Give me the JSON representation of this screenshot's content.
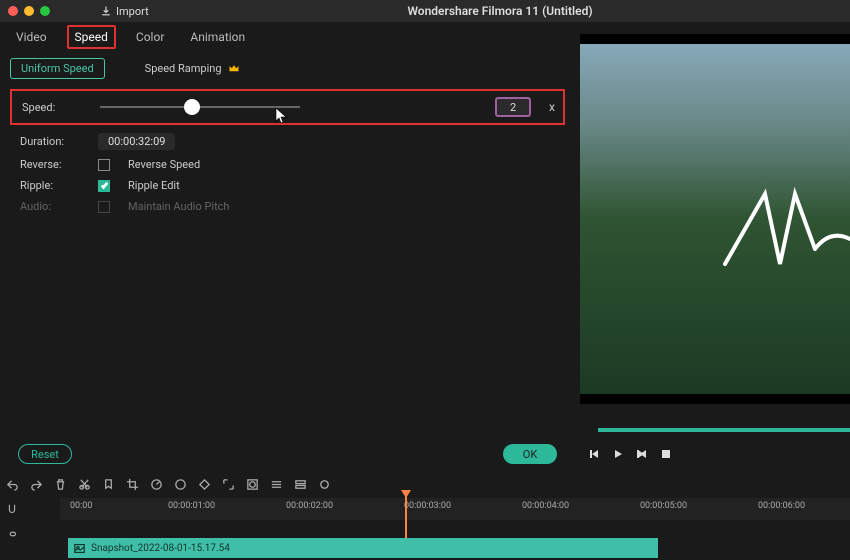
{
  "titlebar": {
    "import_label": "Import",
    "app_title": "Wondershare Filmora 11 (Untitled)"
  },
  "tabs": {
    "video": "Video",
    "speed": "Speed",
    "color": "Color",
    "animation": "Animation"
  },
  "subtabs": {
    "uniform": "Uniform Speed",
    "ramping": "Speed Ramping"
  },
  "speed": {
    "label": "Speed:",
    "value": "2",
    "unit": "x"
  },
  "duration": {
    "label": "Duration:",
    "value": "00:00:32:09"
  },
  "reverse": {
    "label": "Reverse:",
    "option": "Reverse Speed"
  },
  "ripple": {
    "label": "Ripple:",
    "option": "Ripple Edit"
  },
  "audio": {
    "label": "Audio:",
    "option": "Maintain Audio Pitch"
  },
  "buttons": {
    "reset": "Reset",
    "ok": "OK"
  },
  "ruler": [
    "00:00",
    "00:00:01:00",
    "00:00:02:00",
    "00:00:03:00",
    "00:00:04:00",
    "00:00:05:00",
    "00:00:06:00"
  ],
  "clip": {
    "name": "Snapshot_2022-08-01-15.17.54"
  }
}
